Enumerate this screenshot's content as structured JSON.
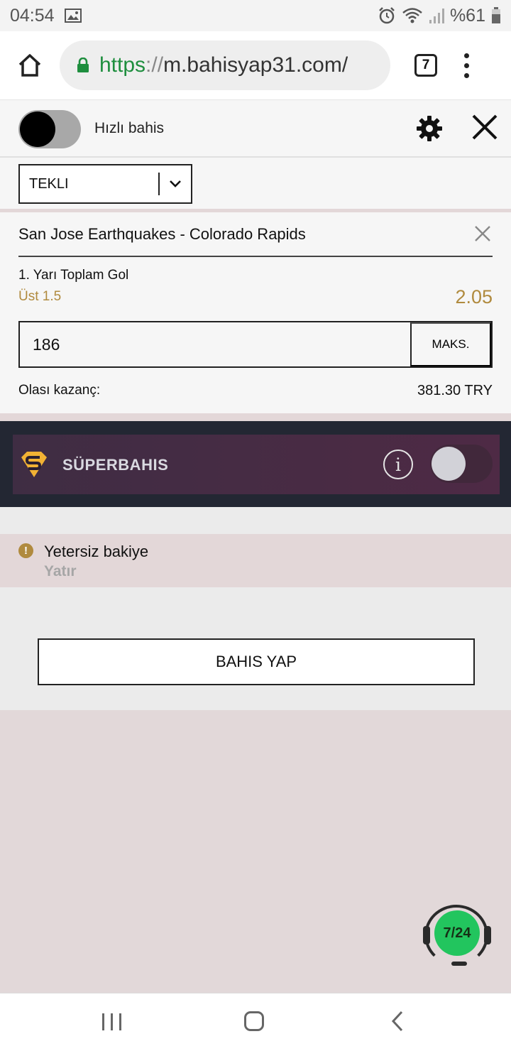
{
  "status_bar": {
    "time": "04:54",
    "battery": "%61"
  },
  "browser": {
    "url_scheme": "https",
    "url_sep": "://",
    "url_host": "m.bahisyap31.com/",
    "tab_count": "7"
  },
  "bet_slip": {
    "quick_bet_label": "Hızlı bahis",
    "bet_type": "TEKLI",
    "event": {
      "title": "San Jose Earthquakes - Colorado Rapids",
      "market": "1. Yarı Toplam Gol",
      "selection": "Üst 1.5",
      "odds": "2.05",
      "stake": "186",
      "max_label": "MAKS.",
      "potential_win_label": "Olası kazanç:",
      "potential_win_value": "381.30 TRY"
    },
    "superbet_label": "SÜPERBAHIS",
    "warning_text": "Yetersiz bakiye",
    "deposit_label": "Yatır",
    "place_bet_label": "BAHIS YAP"
  },
  "chat": {
    "label": "7/24"
  },
  "colors": {
    "accent_gold": "#b08a3e",
    "superbet_bg": "#4e2a45",
    "chat_green": "#22c55e"
  }
}
